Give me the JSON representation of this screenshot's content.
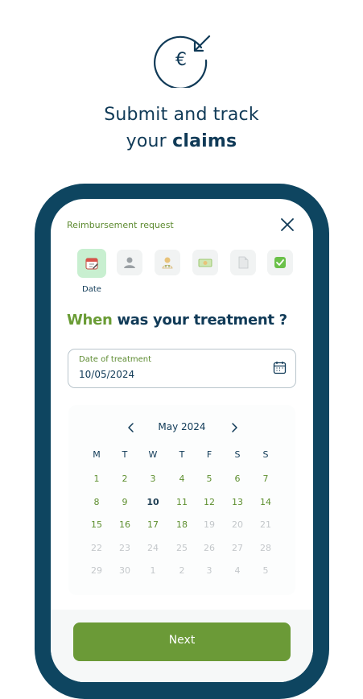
{
  "hero": {
    "icon": "euro-refund-icon",
    "headline_line1": "Submit and track",
    "headline_line2_prefix": "your",
    "headline_line2_bold": "claims"
  },
  "form": {
    "title": "Reimbursement request",
    "close_icon": "close-icon",
    "steps": [
      {
        "icon": "calendar-icon",
        "label": "Date",
        "active": true
      },
      {
        "icon": "person-icon",
        "label": "",
        "active": false
      },
      {
        "icon": "doctor-icon",
        "label": "",
        "active": false
      },
      {
        "icon": "money-icon",
        "label": "",
        "active": false
      },
      {
        "icon": "document-icon",
        "label": "",
        "active": false
      },
      {
        "icon": "check-icon",
        "label": "",
        "active": false
      }
    ],
    "question_highlight": "When",
    "question_rest": "was your treatment ?",
    "date_field": {
      "label": "Date of treatment",
      "value": "10/05/2024",
      "icon": "calendar-icon"
    },
    "calendar": {
      "month": "May 2024",
      "prev_icon": "chevron-left-icon",
      "next_icon": "chevron-right-icon",
      "weekdays": [
        "M",
        "T",
        "W",
        "T",
        "F",
        "S",
        "S"
      ],
      "weeks": [
        [
          "1",
          "2",
          "3",
          "4",
          "5",
          "6",
          "7"
        ],
        [
          "8",
          "9",
          "10",
          "11",
          "12",
          "13",
          "14"
        ],
        [
          "15",
          "16",
          "17",
          "18",
          "19",
          "20",
          "21"
        ],
        [
          "22",
          "23",
          "24",
          "25",
          "26",
          "27",
          "28"
        ],
        [
          "29",
          "30",
          "1",
          "2",
          "3",
          "4",
          "5"
        ]
      ],
      "selected": "10",
      "enabled_through": "18"
    },
    "next_label": "Next"
  },
  "colors": {
    "navy": "#103a57",
    "phone_frame": "#0e4560",
    "green": "#6b9a37",
    "active_step": "#c8efd0"
  }
}
